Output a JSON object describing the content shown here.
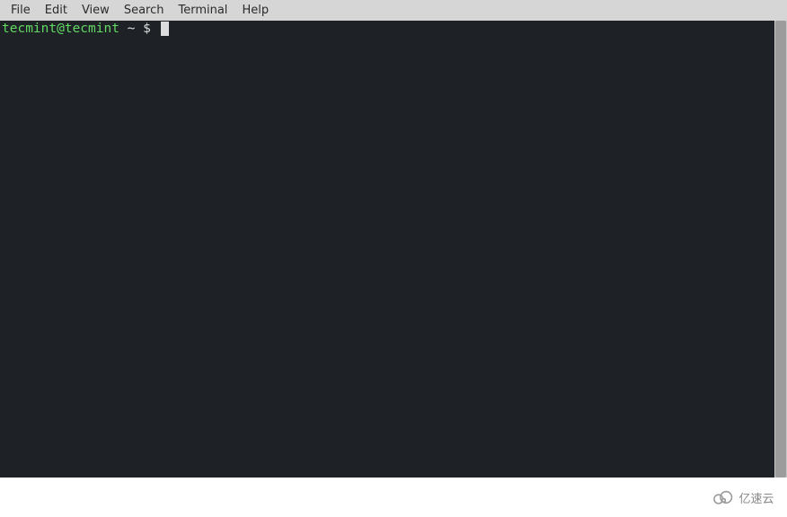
{
  "menubar": {
    "items": [
      "File",
      "Edit",
      "View",
      "Search",
      "Terminal",
      "Help"
    ]
  },
  "terminal": {
    "prompt_user": "tecmint@tecmint",
    "prompt_path": " ~ $ "
  },
  "watermark": {
    "text": "亿速云"
  },
  "colors": {
    "menubar_bg": "#d6d6d6",
    "terminal_bg": "#1e2227",
    "prompt_green": "#62d862",
    "prompt_white": "#dcdcdc"
  }
}
